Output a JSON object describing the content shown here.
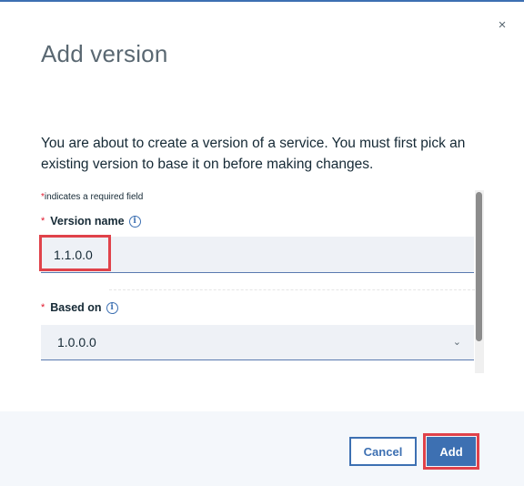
{
  "dialog": {
    "title": "Add version",
    "close_icon": "×",
    "description": "You are about to create a version of a service. You must first pick an existing version to base it on before making changes.",
    "required_note_asterisk": "*",
    "required_note": "indicates a required field"
  },
  "form": {
    "version_name": {
      "asterisk": "*",
      "label": "Version name",
      "info_icon": "i",
      "value": "1.1.0.0"
    },
    "based_on": {
      "asterisk": "*",
      "label": "Based on",
      "info_icon": "i",
      "selected": "1.0.0.0",
      "chevron": "⌄"
    }
  },
  "footer": {
    "cancel_label": "Cancel",
    "add_label": "Add"
  },
  "colors": {
    "accent": "#3d70b2",
    "highlight": "#e0424a",
    "required": "#e0182d"
  }
}
